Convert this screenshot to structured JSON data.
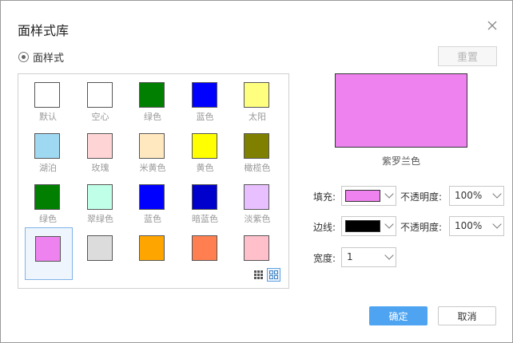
{
  "dialog": {
    "title": "面样式库",
    "close_icon": "close-icon"
  },
  "radio": {
    "label": "面样式",
    "checked": true
  },
  "reset_label": "重置",
  "swatches": [
    {
      "label": "默认",
      "color": "#ffffff"
    },
    {
      "label": "空心",
      "color": "#ffffff"
    },
    {
      "label": "绿色",
      "color": "#007f00"
    },
    {
      "label": "蓝色",
      "color": "#0000ff"
    },
    {
      "label": "太阳",
      "color": "#ffff7f"
    },
    {
      "label": "湖泊",
      "color": "#9fd9f1"
    },
    {
      "label": "玫瑰",
      "color": "#ffd4d4"
    },
    {
      "label": "米黄色",
      "color": "#ffe8c0"
    },
    {
      "label": "黄色",
      "color": "#ffff00"
    },
    {
      "label": "橄榄色",
      "color": "#808000"
    },
    {
      "label": "绿色",
      "color": "#007f00"
    },
    {
      "label": "翠绿色",
      "color": "#c0ffe8"
    },
    {
      "label": "蓝色",
      "color": "#0000ff"
    },
    {
      "label": "暗蓝色",
      "color": "#0000cc"
    },
    {
      "label": "淡紫色",
      "color": "#e8c0ff"
    },
    {
      "label": "",
      "color": "#ee82ee"
    },
    {
      "label": "",
      "color": "#dcdcdc"
    },
    {
      "label": "",
      "color": "#ffa500"
    },
    {
      "label": "",
      "color": "#ff7f50"
    },
    {
      "label": "",
      "color": "#ffc0cb"
    }
  ],
  "selected_index": 15,
  "view_icons": [
    "small-grid-icon",
    "large-grid-icon"
  ],
  "preview": {
    "color": "#ee82ee",
    "label": "紫罗兰色"
  },
  "fill": {
    "label": "填充:",
    "color": "#ee82ee",
    "opacity_label": "不透明度:",
    "opacity": "100%"
  },
  "border": {
    "label": "边线:",
    "color": "#000000",
    "opacity_label": "不透明度:",
    "opacity": "100%"
  },
  "width": {
    "label": "宽度:",
    "value": "1"
  },
  "buttons": {
    "ok": "确定",
    "cancel": "取消"
  }
}
